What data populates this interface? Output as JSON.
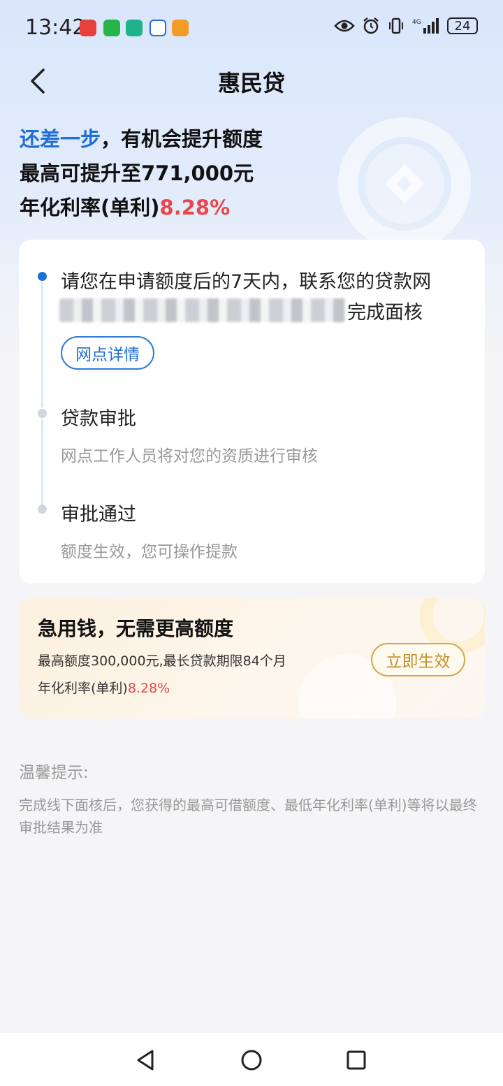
{
  "status_bar": {
    "time": "13:42",
    "battery": "24",
    "notification_colors": [
      "#e8403a",
      "#26b54a",
      "#1fb38b",
      "#2a6be0",
      "#f29b26"
    ]
  },
  "header": {
    "title": "惠民贷"
  },
  "hero": {
    "highlight": "还差一步",
    "headline_rest": "，有机会提升额度",
    "max_limit": "最高可提升至771,000元",
    "rate_label": "年化利率(单利)",
    "rate_value": "8.28%"
  },
  "steps": {
    "step1_line1": "请您在申请额度后的7天内，联系您的贷款网",
    "step1_line2_end": "完成面核",
    "step1_button": "网点详情",
    "step2_title": "贷款审批",
    "step2_desc": "网点工作人员将对您的资质进行审核",
    "step3_title": "审批通过",
    "step3_desc": "额度生效，您可操作提款"
  },
  "offer": {
    "title": "急用钱，无需更高额度",
    "detail": "最高额度300,000元,最长贷款期限84个月",
    "rate_label": "年化利率(单利)",
    "rate_value": "8.28%",
    "button": "立即生效"
  },
  "tips": {
    "title": "温馨提示:",
    "body": "完成线下面核后，您获得的最高可借额度、最低年化利率(单利)等将以最终审批结果为准"
  },
  "colors": {
    "accent_blue": "#1e6fd6",
    "rate_red": "#e8484c",
    "gold": "#c4902b"
  }
}
